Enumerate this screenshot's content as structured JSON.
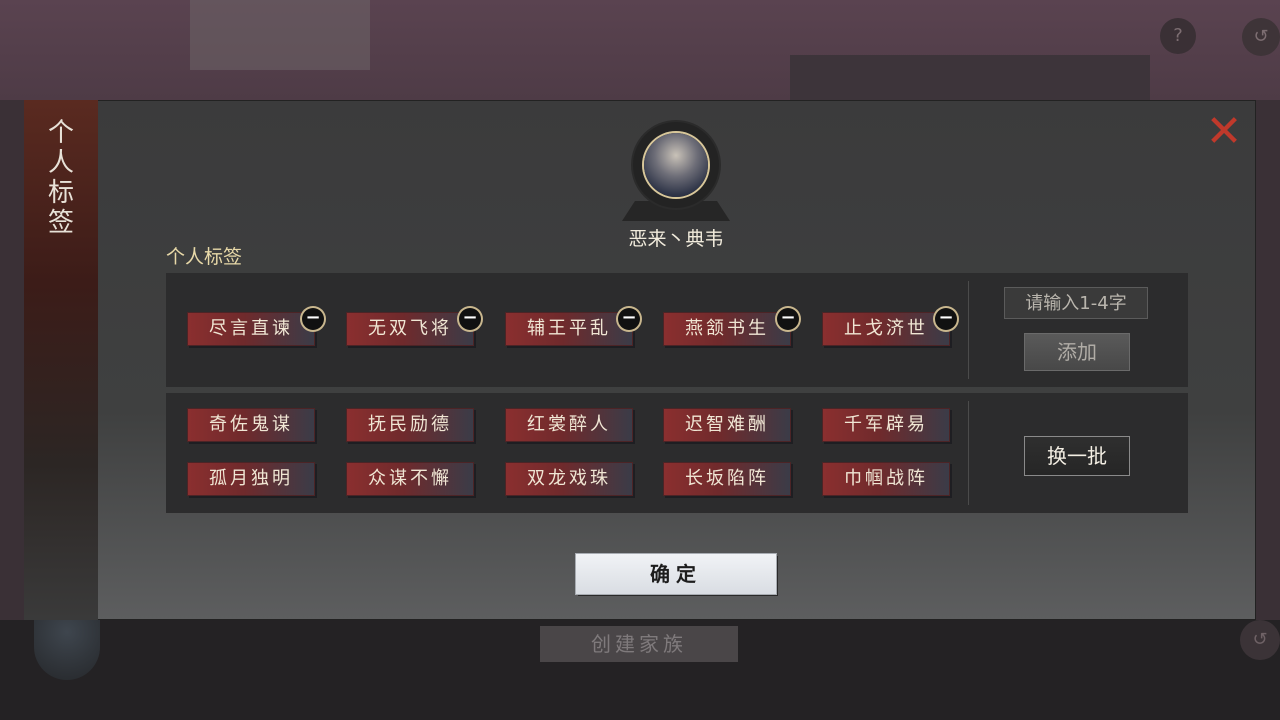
{
  "background": {
    "help_glyph": "?",
    "back_glyph": "↺",
    "create_family_label": "创建家族"
  },
  "dialog": {
    "side_title": "个人标签",
    "close_glyph": "✕",
    "user_name": "恶来丶典韦",
    "section_label": "个人标签",
    "current_tags": [
      "尽言直谏",
      "无双飞将",
      "辅王平乱",
      "燕颔书生",
      "止戈济世"
    ],
    "remove_glyph": "−",
    "input_placeholder": "请输入1-4字",
    "add_label": "添加",
    "suggested_tags": [
      [
        "奇佐鬼谋",
        "抚民励德",
        "红裳醉人",
        "迟智难酬",
        "千军辟易"
      ],
      [
        "孤月独明",
        "众谋不懈",
        "双龙戏珠",
        "长坂陷阵",
        "巾帼战阵"
      ]
    ],
    "swap_label": "换一批",
    "confirm_label": "确定"
  },
  "colors": {
    "tag_red": "#8b2f2f",
    "close_red": "#c0392b",
    "label_gold": "#e8d9a8"
  }
}
